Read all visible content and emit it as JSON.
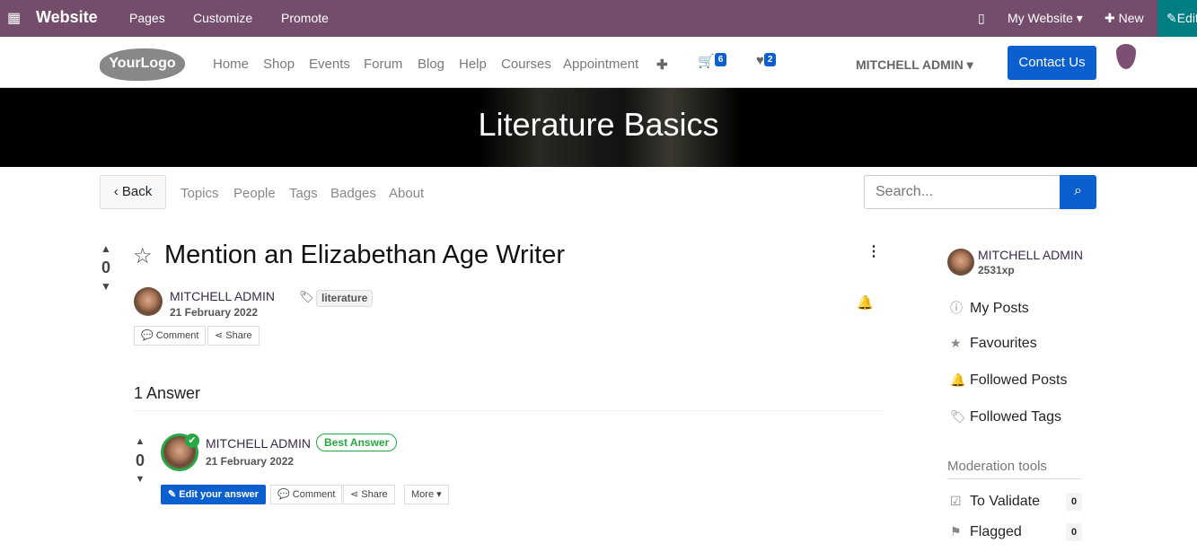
{
  "topbar": {
    "app": "Website",
    "menus": [
      "Pages",
      "Customize",
      "Promote"
    ],
    "site": "My Website",
    "new": "New",
    "edit": "Edit"
  },
  "header": {
    "logo": "YourLogo",
    "nav": [
      "Home",
      "Shop",
      "Events",
      "Forum",
      "Blog",
      "Help",
      "Courses",
      "Appointment"
    ],
    "cart_count": "6",
    "wishlist_count": "2",
    "user": "MITCHELL ADMIN",
    "contact": "Contact Us"
  },
  "banner": {
    "title": "Literature Basics"
  },
  "subnav": {
    "back": "Back",
    "links": [
      "Topics",
      "People",
      "Tags",
      "Badges",
      "About"
    ],
    "search_placeholder": "Search..."
  },
  "question": {
    "votes": "0",
    "title": "Mention an Elizabethan Age Writer",
    "author": "MITCHELL ADMIN",
    "date": "21 February 2022",
    "tag": "literature",
    "comment": "Comment",
    "share": "Share"
  },
  "answers": {
    "heading": "1 Answer",
    "items": [
      {
        "votes": "0",
        "author": "MITCHELL ADMIN",
        "badge": "Best Answer",
        "date": "21 February 2022",
        "edit": "Edit your answer",
        "comment": "Comment",
        "share": "Share",
        "more": "More"
      }
    ]
  },
  "sidebar": {
    "user": "MITCHELL ADMIN",
    "xp": "2531xp",
    "links": [
      "My Posts",
      "Favourites",
      "Followed Posts",
      "Followed Tags"
    ],
    "moderation_title": "Moderation tools",
    "moderation": [
      {
        "label": "To Validate",
        "count": "0"
      },
      {
        "label": "Flagged",
        "count": "0"
      }
    ]
  },
  "colors": {
    "topbar": "#734d6a",
    "primary": "#0b5fce",
    "success": "#28a745"
  }
}
